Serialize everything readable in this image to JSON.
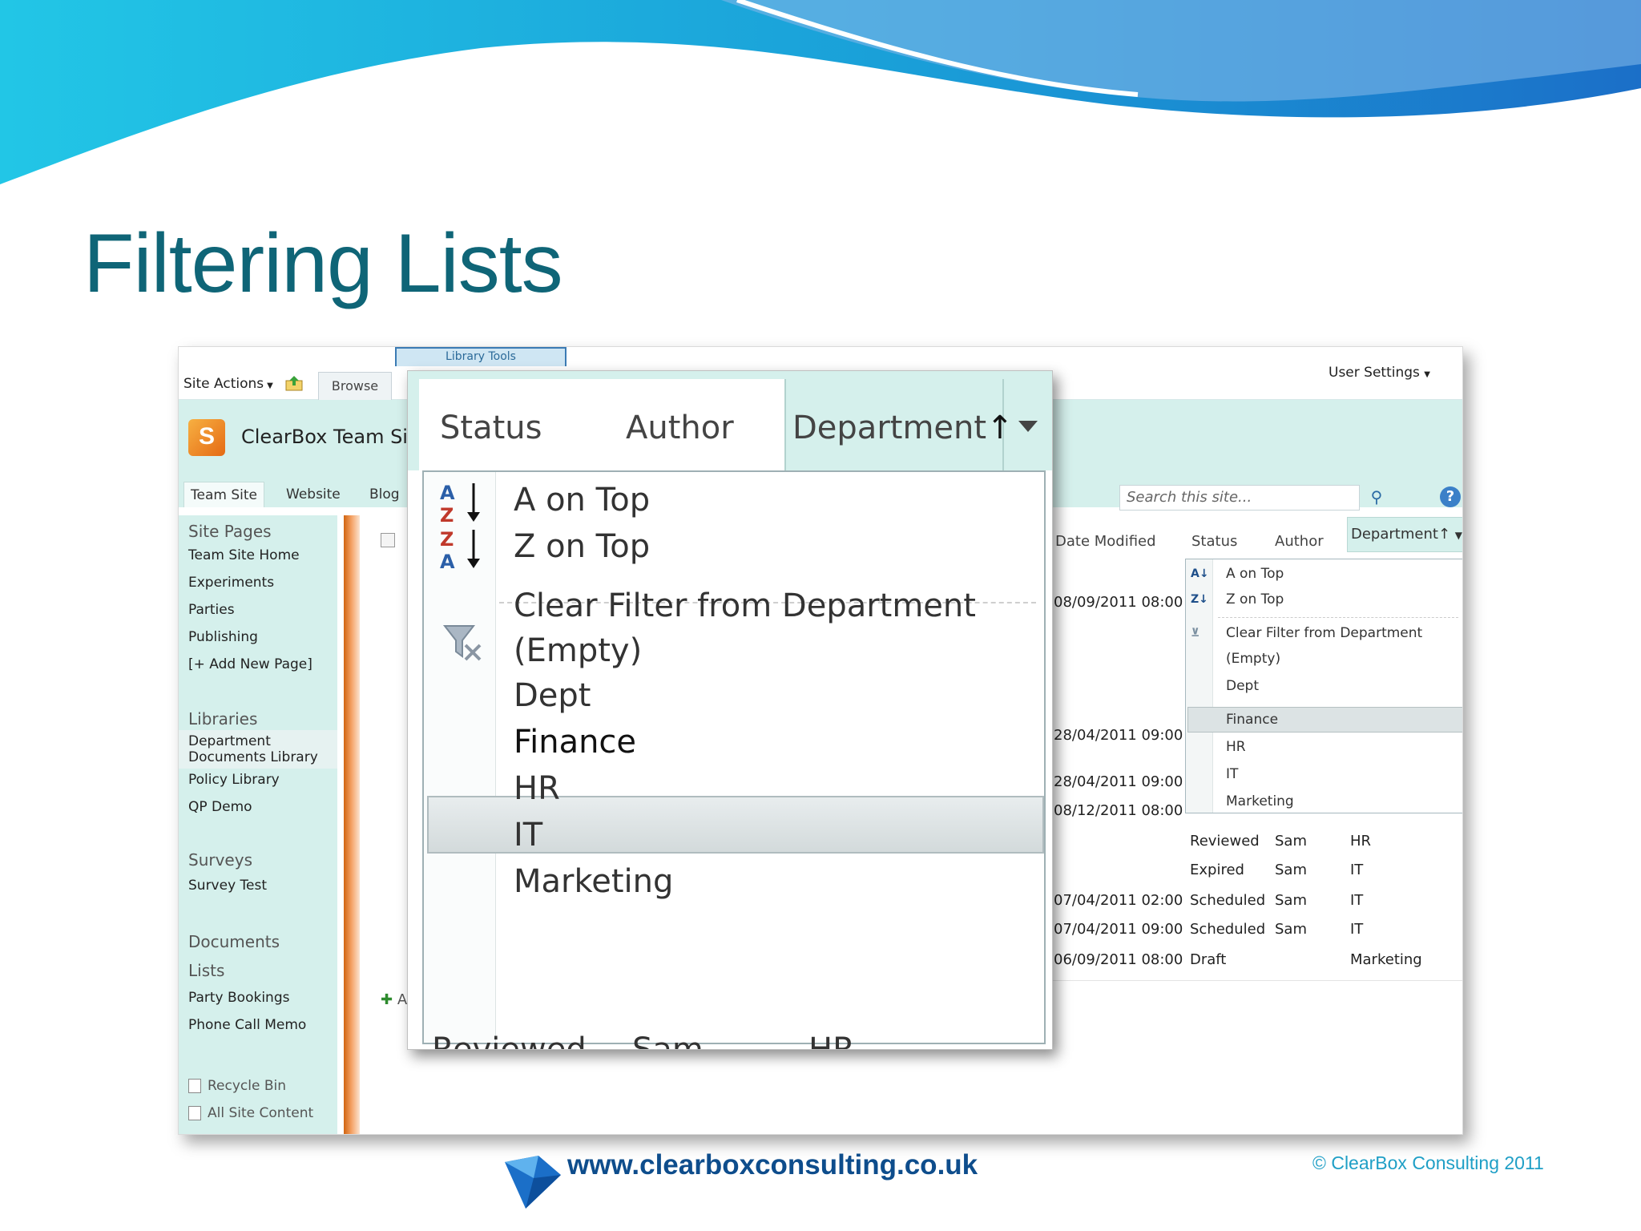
{
  "slide": {
    "title": "Filtering Lists"
  },
  "ribbon": {
    "site_actions": "Site Actions",
    "browse_tab": "Browse",
    "library_tools": "Library Tools",
    "user_settings": "User Settings"
  },
  "site": {
    "title": "ClearBox Team Site"
  },
  "top_nav": [
    "Team Site",
    "Website",
    "Blog"
  ],
  "search": {
    "placeholder": "Search this site..."
  },
  "quick_launch": {
    "site_pages_heading": "Site Pages",
    "site_pages": [
      "Team Site Home",
      "Experiments",
      "Parties",
      "Publishing",
      "[+ Add New Page]"
    ],
    "libraries_heading": "Libraries",
    "libraries": [
      "Department Documents Library",
      "Policy Library",
      "QP Demo"
    ],
    "surveys_heading": "Surveys",
    "surveys": [
      "Survey Test"
    ],
    "documents_heading": "Documents",
    "lists_heading": "Lists",
    "lists": [
      "Party Bookings",
      "Phone Call Memo"
    ],
    "recycle_bin": "Recycle Bin",
    "all_site_content": "All Site Content"
  },
  "list": {
    "columns": [
      "Date Modified",
      "Status",
      "Author",
      "Department"
    ],
    "department_sort_mark": "↑",
    "rows": [
      {
        "date": "08/09/2011 08:00",
        "status": "",
        "author": "",
        "dept": ""
      },
      {
        "date": "28/04/2011 09:00",
        "status": "",
        "author": "",
        "dept": ""
      },
      {
        "date": "28/04/2011 09:00",
        "status": "",
        "author": "",
        "dept": ""
      },
      {
        "date": "08/12/2011 08:00",
        "status": "",
        "author": "",
        "dept": ""
      },
      {
        "date": "",
        "status": "Reviewed",
        "author": "Sam",
        "dept": "HR"
      },
      {
        "date": "",
        "status": "Expired",
        "author": "Sam",
        "dept": "IT"
      },
      {
        "date": "07/04/2011 02:00",
        "status": "Scheduled",
        "author": "Sam",
        "dept": "IT"
      },
      {
        "date": "07/04/2011 09:00",
        "status": "Scheduled",
        "author": "Sam",
        "dept": "IT"
      },
      {
        "date": "06/09/2011 08:00",
        "status": "Draft",
        "author": "",
        "dept": "Marketing"
      }
    ],
    "add_document_fragment": "A"
  },
  "filter_menu": {
    "sort_asc": "A on Top",
    "sort_desc": "Z on Top",
    "clear_filter": "Clear Filter from Department",
    "values": [
      "(Empty)",
      "Dept",
      "Finance",
      "HR",
      "IT",
      "Marketing"
    ],
    "selected": "Finance"
  },
  "zoom": {
    "columns": [
      "Status",
      "Author",
      "Department"
    ],
    "sort_mark": "↑",
    "bottom_row_fragment": [
      "Reviewed",
      "Sam",
      "HR"
    ]
  },
  "footer": {
    "url": "www.clearboxconsulting.co.uk",
    "copyright": "© ClearBox Consulting 2011"
  },
  "colors": {
    "title_teal": "#0f6577",
    "sharepoint_teal": "#d5f0ec",
    "wave_blue": "#1a9fd8",
    "footer_url": "#0e4d8c",
    "copyright": "#1f9fc6"
  },
  "icons": [
    "sort-az-icon",
    "sort-za-icon",
    "clear-filter-icon",
    "search-icon",
    "help-icon",
    "sharepoint-logo-icon",
    "recycle-bin-icon",
    "clearbox-gem-logo"
  ]
}
